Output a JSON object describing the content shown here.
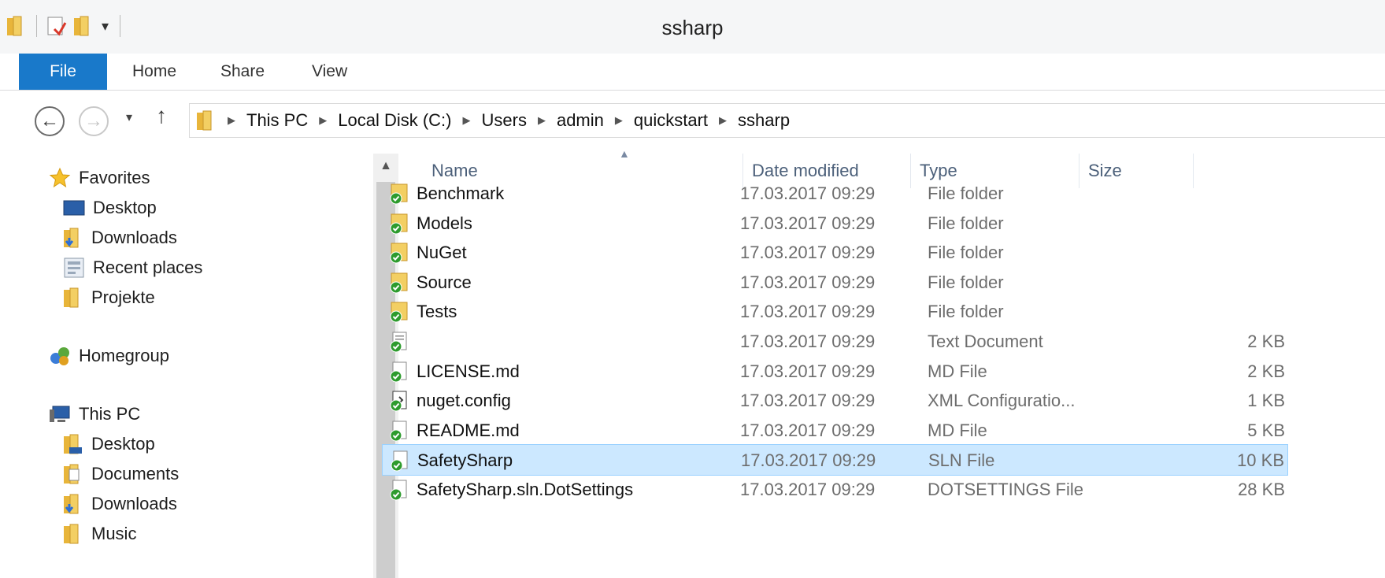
{
  "window": {
    "title": "ssharp"
  },
  "ribbon": {
    "tabs": [
      {
        "label": "File"
      },
      {
        "label": "Home"
      },
      {
        "label": "Share"
      },
      {
        "label": "View"
      }
    ]
  },
  "address": {
    "crumbs": [
      "This PC",
      "Local Disk (C:)",
      "Users",
      "admin",
      "quickstart",
      "ssharp"
    ]
  },
  "nav": {
    "items": [
      {
        "label": "Favorites",
        "icon": "star-icon"
      },
      {
        "label": "Desktop",
        "icon": "desktop-icon"
      },
      {
        "label": "Downloads",
        "icon": "downloads-folder-icon"
      },
      {
        "label": "Recent places",
        "icon": "recent-places-icon"
      },
      {
        "label": "Projekte",
        "icon": "folder-icon"
      },
      {
        "label": "Homegroup",
        "icon": "homegroup-icon"
      },
      {
        "label": "This PC",
        "icon": "computer-icon"
      },
      {
        "label": "Desktop",
        "icon": "desktop-folder-icon"
      },
      {
        "label": "Documents",
        "icon": "documents-folder-icon"
      },
      {
        "label": "Downloads",
        "icon": "downloads-folder-icon"
      },
      {
        "label": "Music",
        "icon": "music-folder-icon"
      }
    ]
  },
  "columns": {
    "name": "Name",
    "date": "Date modified",
    "type": "Type",
    "size": "Size"
  },
  "files": [
    {
      "name": "Benchmark",
      "date": "17.03.2017 09:29",
      "type": "File folder",
      "size": "",
      "icon": "folder-checked-icon"
    },
    {
      "name": "Models",
      "date": "17.03.2017 09:29",
      "type": "File folder",
      "size": "",
      "icon": "folder-checked-icon"
    },
    {
      "name": "NuGet",
      "date": "17.03.2017 09:29",
      "type": "File folder",
      "size": "",
      "icon": "folder-checked-icon"
    },
    {
      "name": "Source",
      "date": "17.03.2017 09:29",
      "type": "File folder",
      "size": "",
      "icon": "folder-checked-icon"
    },
    {
      "name": "Tests",
      "date": "17.03.2017 09:29",
      "type": "File folder",
      "size": "",
      "icon": "folder-checked-icon"
    },
    {
      "name": "",
      "date": "17.03.2017 09:29",
      "type": "Text Document",
      "size": "2 KB",
      "icon": "text-doc-checked-icon"
    },
    {
      "name": "LICENSE.md",
      "date": "17.03.2017 09:29",
      "type": "MD File",
      "size": "2 KB",
      "icon": "file-checked-icon"
    },
    {
      "name": "nuget.config",
      "date": "17.03.2017 09:29",
      "type": "XML Configuratio...",
      "size": "1 KB",
      "icon": "config-checked-icon"
    },
    {
      "name": "README.md",
      "date": "17.03.2017 09:29",
      "type": "MD File",
      "size": "5 KB",
      "icon": "file-checked-icon"
    },
    {
      "name": "SafetySharp",
      "date": "17.03.2017 09:29",
      "type": "SLN File",
      "size": "10 KB",
      "icon": "file-checked-icon"
    },
    {
      "name": "SafetySharp.sln.DotSettings",
      "date": "17.03.2017 09:29",
      "type": "DOTSETTINGS File",
      "size": "28 KB",
      "icon": "file-checked-icon"
    }
  ]
}
